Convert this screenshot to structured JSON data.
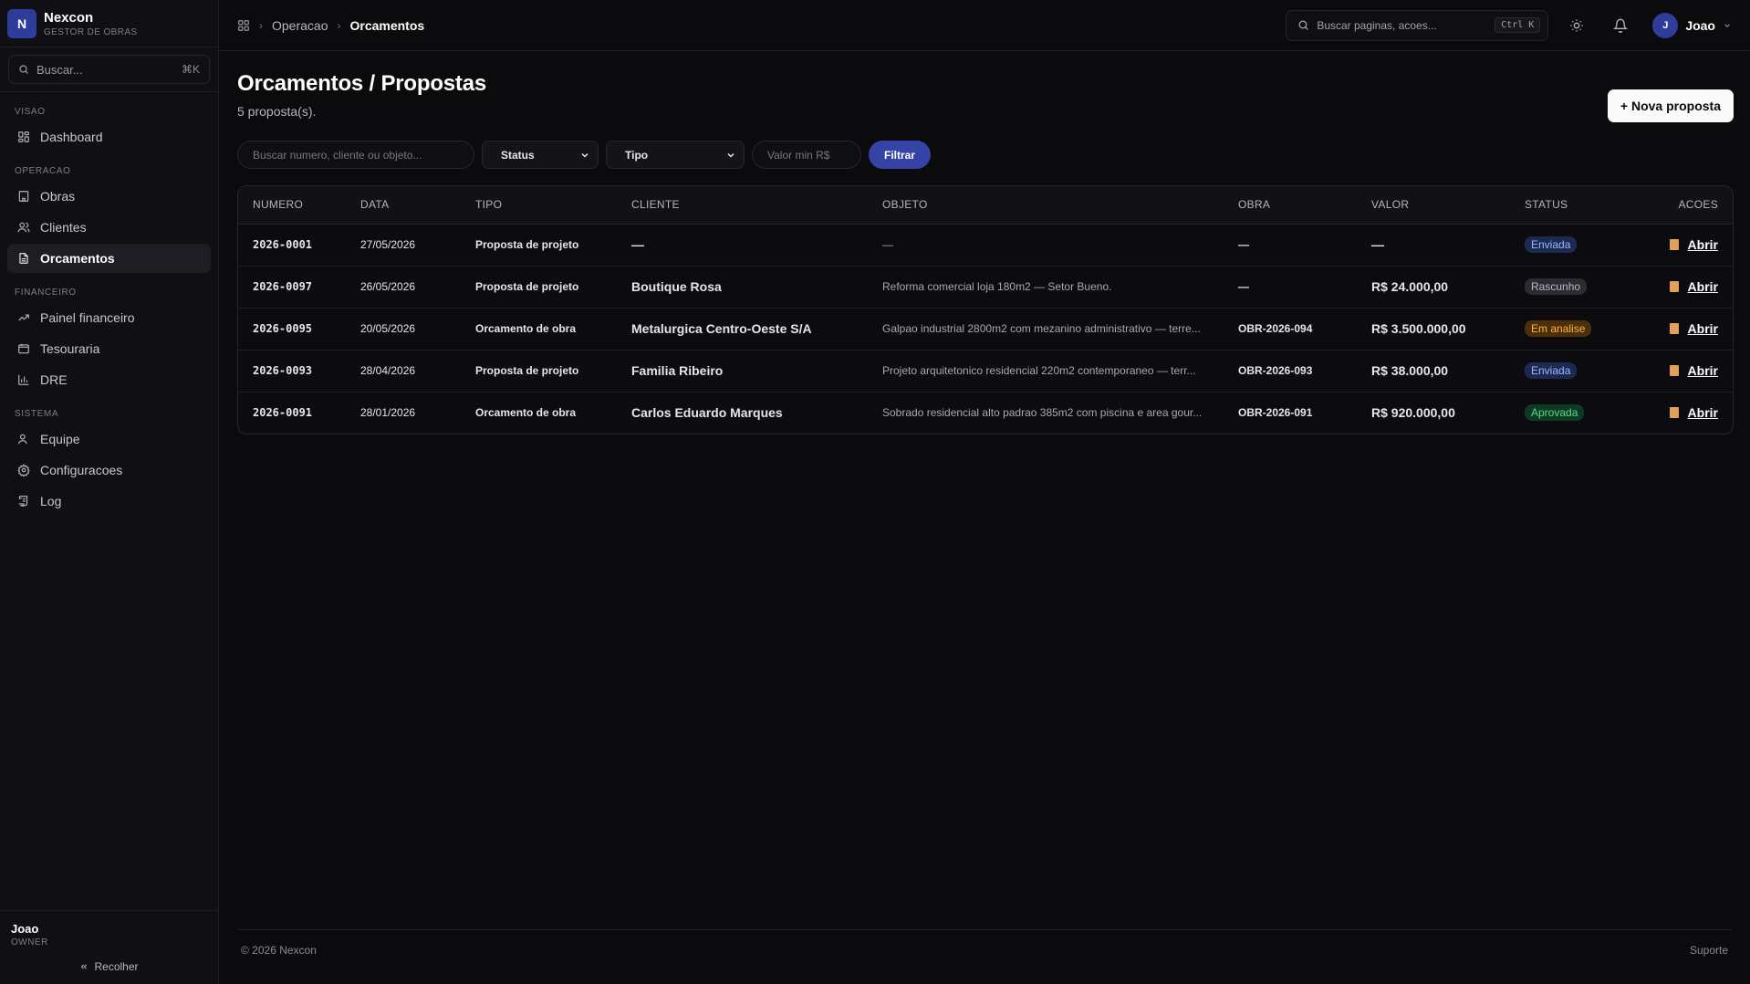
{
  "brand": {
    "logo": "N",
    "name": "Nexcon",
    "subtitle": "GESTOR DE OBRAS"
  },
  "sidebar": {
    "search": {
      "placeholder": "Buscar...",
      "shortcut": "⌘K"
    },
    "sections": [
      {
        "label": "VISAO",
        "items": [
          {
            "label": "Dashboard",
            "icon": "grid-icon"
          }
        ]
      },
      {
        "label": "OPERACAO",
        "items": [
          {
            "label": "Obras",
            "icon": "building-icon"
          },
          {
            "label": "Clientes",
            "icon": "users-icon"
          },
          {
            "label": "Orcamentos",
            "icon": "file-icon",
            "active": true
          }
        ]
      },
      {
        "label": "FINANCEIRO",
        "items": [
          {
            "label": "Painel financeiro",
            "icon": "trending-up-icon"
          },
          {
            "label": "Tesouraria",
            "icon": "wallet-icon"
          },
          {
            "label": "DRE",
            "icon": "bar-chart-icon"
          }
        ]
      },
      {
        "label": "SISTEMA",
        "items": [
          {
            "label": "Equipe",
            "icon": "user-icon"
          },
          {
            "label": "Configuracoes",
            "icon": "gear-icon"
          },
          {
            "label": "Log",
            "icon": "scroll-icon"
          }
        ]
      }
    ],
    "user": {
      "name": "Joao",
      "role": "OWNER"
    },
    "collapse_label": "Recolher"
  },
  "topbar": {
    "breadcrumb": [
      "Operacao",
      "Orcamentos"
    ],
    "search": {
      "placeholder": "Buscar paginas, acoes...",
      "shortcut": "Ctrl K"
    },
    "user": {
      "initial": "J",
      "name": "Joao"
    }
  },
  "page": {
    "title": "Orcamentos / Propostas",
    "subtitle": "5 proposta(s).",
    "new_button": "+ Nova proposta"
  },
  "filters": {
    "search_placeholder": "Buscar numero, cliente ou objeto...",
    "status": "Status",
    "tipo": "Tipo",
    "valor_placeholder": "Valor min R$",
    "button": "Filtrar"
  },
  "table": {
    "columns": [
      "NUMERO",
      "DATA",
      "TIPO",
      "CLIENTE",
      "OBJETO",
      "OBRA",
      "VALOR",
      "STATUS",
      "ACOES"
    ],
    "rows": [
      {
        "numero": "2026-0001",
        "data": "27/05/2026",
        "tipo": "Proposta de projeto",
        "cliente": "—",
        "objeto": "—",
        "obra": "—",
        "valor": "—",
        "status": "Enviada",
        "status_kind": "enviada",
        "acao": "Abrir"
      },
      {
        "numero": "2026-0097",
        "data": "26/05/2026",
        "tipo": "Proposta de projeto",
        "cliente": "Boutique Rosa",
        "objeto": "Reforma comercial loja 180m2 — Setor Bueno.",
        "obra": "—",
        "valor": "R$ 24.000,00",
        "status": "Rascunho",
        "status_kind": "rascunho",
        "acao": "Abrir"
      },
      {
        "numero": "2026-0095",
        "data": "20/05/2026",
        "tipo": "Orcamento de obra",
        "cliente": "Metalurgica Centro-Oeste S/A",
        "objeto": "Galpao industrial 2800m2 com mezanino administrativo — terre...",
        "obra": "OBR-2026-094",
        "valor": "R$ 3.500.000,00",
        "status": "Em analise",
        "status_kind": "analise",
        "acao": "Abrir"
      },
      {
        "numero": "2026-0093",
        "data": "28/04/2026",
        "tipo": "Proposta de projeto",
        "cliente": "Familia Ribeiro",
        "objeto": "Projeto arquitetonico residencial 220m2 contemporaneo — terr...",
        "obra": "OBR-2026-093",
        "valor": "R$ 38.000,00",
        "status": "Enviada",
        "status_kind": "enviada",
        "acao": "Abrir"
      },
      {
        "numero": "2026-0091",
        "data": "28/01/2026",
        "tipo": "Orcamento de obra",
        "cliente": "Carlos Eduardo Marques",
        "objeto": "Sobrado residencial alto padrao 385m2 com piscina e area gour...",
        "obra": "OBR-2026-091",
        "valor": "R$ 920.000,00",
        "status": "Aprovada",
        "status_kind": "aprovada",
        "acao": "Abrir"
      }
    ]
  },
  "footer": {
    "copyright": "© 2026 Nexcon",
    "support": "Suporte"
  }
}
